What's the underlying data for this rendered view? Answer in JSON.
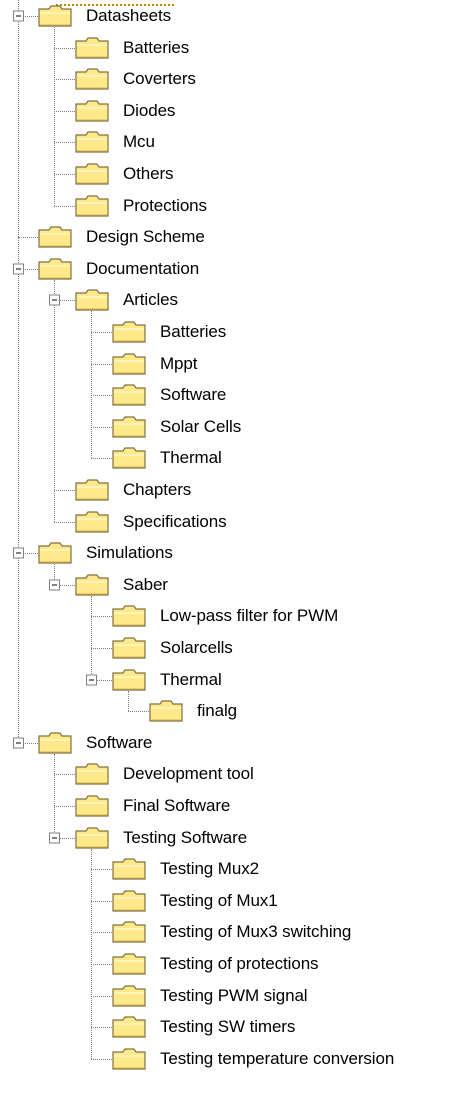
{
  "tree": {
    "nodes": [
      {
        "label": "Datasheets",
        "level": 0,
        "expanded": true
      },
      {
        "label": "Batteries",
        "level": 1
      },
      {
        "label": "Coverters",
        "level": 1
      },
      {
        "label": "Diodes",
        "level": 1
      },
      {
        "label": "Mcu",
        "level": 1
      },
      {
        "label": "Others",
        "level": 1
      },
      {
        "label": "Protections",
        "level": 1
      },
      {
        "label": "Design Scheme",
        "level": 0
      },
      {
        "label": "Documentation",
        "level": 0,
        "expanded": true
      },
      {
        "label": "Articles",
        "level": 1,
        "expanded": true
      },
      {
        "label": "Batteries",
        "level": 2
      },
      {
        "label": "Mppt",
        "level": 2
      },
      {
        "label": "Software",
        "level": 2
      },
      {
        "label": "Solar Cells",
        "level": 2
      },
      {
        "label": "Thermal",
        "level": 2
      },
      {
        "label": "Chapters",
        "level": 1
      },
      {
        "label": "Specifications",
        "level": 1
      },
      {
        "label": "Simulations",
        "level": 0,
        "expanded": true
      },
      {
        "label": "Saber",
        "level": 1,
        "expanded": true
      },
      {
        "label": "Low-pass filter for PWM",
        "level": 2
      },
      {
        "label": "Solarcells",
        "level": 2
      },
      {
        "label": "Thermal",
        "level": 2,
        "expanded": true
      },
      {
        "label": "finalg",
        "level": 3
      },
      {
        "label": "Software",
        "level": 0,
        "expanded": true
      },
      {
        "label": "Development tool",
        "level": 1
      },
      {
        "label": "Final Software",
        "level": 1
      },
      {
        "label": "Testing Software",
        "level": 1,
        "expanded": true
      },
      {
        "label": "Testing Mux2",
        "level": 2
      },
      {
        "label": "Testing of Mux1",
        "level": 2
      },
      {
        "label": "Testing of Mux3 switching",
        "level": 2
      },
      {
        "label": "Testing of protections",
        "level": 2
      },
      {
        "label": "Testing PWM signal",
        "level": 2
      },
      {
        "label": "Testing SW timers",
        "level": 2
      },
      {
        "label": "Testing temperature conversion",
        "level": 2
      }
    ]
  },
  "colors": {
    "folder_fill": "#ffe98a",
    "folder_stroke": "#807040",
    "tree_line": "#808080"
  },
  "icons": {
    "folder": "folder-icon",
    "expander": "collapse-minus-icon"
  }
}
